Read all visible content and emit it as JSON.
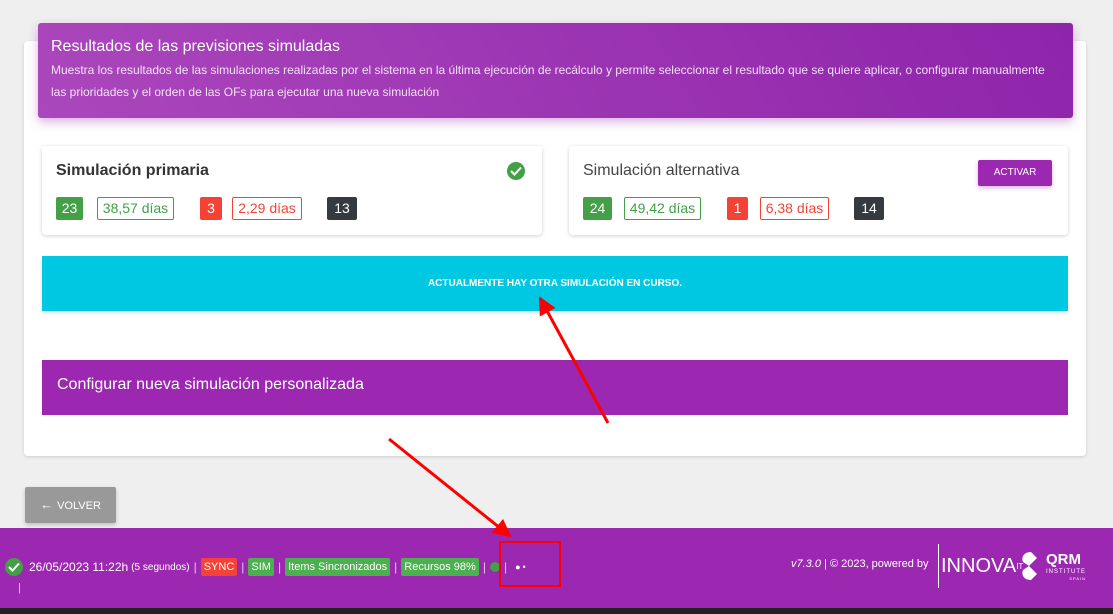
{
  "header": {
    "title": "Resultados de las previsiones simuladas",
    "description": "Muestra los resultados de las simulaciones realizadas por el sistema en la última ejecución de recálculo y permite seleccionar el resultado que se quiere aplicar, o configurar manualmente las prioridades y el orden de las OFs para ejecutar una nueva simulación"
  },
  "primary": {
    "title": "Simulación primaria",
    "ok_count": "23",
    "ok_days": "38,57 días",
    "late_count": "3",
    "late_days": "2,29 días",
    "total": "13"
  },
  "alternative": {
    "title": "Simulación alternativa",
    "activate_label": "ACTIVAR",
    "ok_count": "24",
    "ok_days": "49,42 días",
    "late_count": "1",
    "late_days": "6,38 días",
    "total": "14"
  },
  "banner": {
    "text": "ACTUALMENTE HAY OTRA SIMULACIÓN EN CURSO."
  },
  "config": {
    "title": "Configurar nueva simulación personalizada"
  },
  "back": {
    "label": "VOLVER"
  },
  "footer": {
    "datetime": "26/05/2023 11:22h",
    "elapsed": "(5 segundos)",
    "sync": "SYNC",
    "sim": "SIM",
    "items": "Items Sincronizados",
    "recursos": "Recursos 98%",
    "separator": "|",
    "version": "v7.3.0",
    "copyright": " | © 2023, powered by",
    "innova": "INNOVA",
    "innova_sup": "IT",
    "qrm": "QRM",
    "qrm_sub": "INSTITUTE",
    "qrm_country": "SPAIN"
  },
  "colors": {
    "purple": "#9c27b0",
    "cyan": "#00c8e3",
    "green": "#43a047",
    "red": "#f44336",
    "dark": "#343a40",
    "annotation": "#ff0000"
  }
}
